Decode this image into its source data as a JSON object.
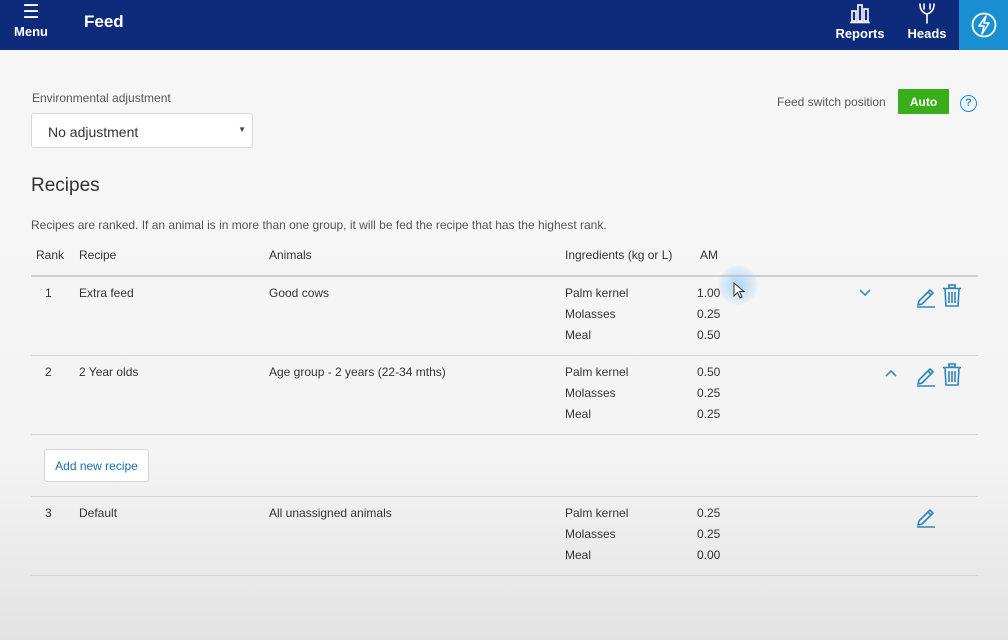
{
  "header": {
    "menu_label": "Menu",
    "menu_icon": "hamburger-icon",
    "title": "Feed",
    "nav": [
      {
        "label": "Reports",
        "icon": "bar-chart-icon"
      },
      {
        "label": "Heads",
        "icon": "heads-icon"
      }
    ],
    "status_icon": "lightning-icon",
    "colors": {
      "bar": "#0d2b7a",
      "tile": "#1a8fd1"
    }
  },
  "environmental": {
    "label": "Environmental adjustment",
    "selected": "No adjustment"
  },
  "feed_switch": {
    "label": "Feed switch position",
    "button": "Auto",
    "button_color": "#3aae1a",
    "help_icon": "question-icon"
  },
  "recipes": {
    "title": "Recipes",
    "note": "Recipes are ranked. If an animal is in more than one group, it will be fed the recipe that has the highest rank.",
    "columns": [
      "Rank",
      "Recipe",
      "Animals",
      "Ingredients (kg or L)",
      "AM"
    ],
    "rows": [
      {
        "rank": "1",
        "recipe": "Extra feed",
        "animals": "Good cows",
        "ingredients": [
          {
            "name": "Palm kernel",
            "am": "1.00"
          },
          {
            "name": "Molasses",
            "am": "0.25"
          },
          {
            "name": "Meal",
            "am": "0.50"
          }
        ]
      },
      {
        "rank": "2",
        "recipe": "2 Year olds",
        "animals": "Age group - 2 years (22-34 mths)",
        "ingredients": [
          {
            "name": "Palm kernel",
            "am": "0.50"
          },
          {
            "name": "Molasses",
            "am": "0.25"
          },
          {
            "name": "Meal",
            "am": "0.25"
          }
        ]
      },
      {
        "rank": "3",
        "recipe": "Default",
        "animals": "All unassigned animals",
        "ingredients": [
          {
            "name": "Palm kernel",
            "am": "0.25"
          },
          {
            "name": "Molasses",
            "am": "0.25"
          },
          {
            "name": "Meal",
            "am": "0.00"
          }
        ]
      }
    ],
    "add_button": "Add new recipe"
  }
}
